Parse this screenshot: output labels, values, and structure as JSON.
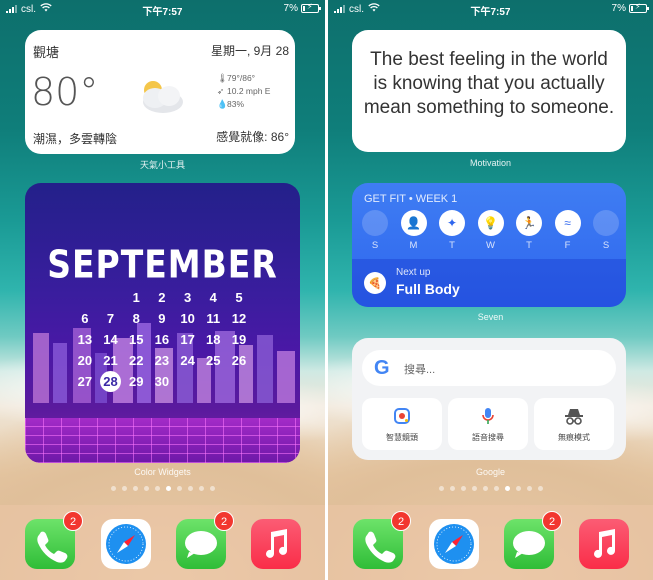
{
  "status": {
    "carrier": "csl.",
    "time": "下午7:57",
    "battery": "7%"
  },
  "left": {
    "weather": {
      "location": "觀塘",
      "date": "星期一, 9月 28",
      "temperature": "80°",
      "hi_lo": "79°/86°",
      "wind": "10.2 mph E",
      "humidity": "83%",
      "description": "潮濕，多雲轉陰",
      "feels_like": "感覺就像: 86°",
      "caption": "天氣小工具"
    },
    "calendar": {
      "month": "SEPTEMBER",
      "today": "28",
      "weeks": [
        [
          "",
          "",
          "1",
          "2",
          "3",
          "4",
          "5"
        ],
        [
          "6",
          "7",
          "8",
          "9",
          "10",
          "11",
          "12"
        ],
        [
          "13",
          "14",
          "15",
          "16",
          "17",
          "18",
          "19"
        ],
        [
          "20",
          "21",
          "22",
          "23",
          "24",
          "25",
          "26"
        ],
        [
          "27",
          "28",
          "29",
          "30",
          "",
          "",
          ""
        ]
      ],
      "caption": "Color Widgets"
    }
  },
  "right": {
    "motivation": {
      "quote": "The best feeling in the world is knowing that you actually mean something to someone.",
      "caption": "Motivation"
    },
    "fit": {
      "title": "GET FIT • WEEK 1",
      "days": [
        "S",
        "M",
        "T",
        "W",
        "T",
        "F",
        "S"
      ],
      "active": [
        false,
        true,
        true,
        true,
        true,
        true,
        false
      ],
      "next_up": "Next up",
      "workout": "Full Body",
      "caption": "Seven"
    },
    "google": {
      "placeholder": "搜尋...",
      "buttons": [
        "智慧鏡頭",
        "語音搜尋",
        "無痕模式"
      ],
      "caption": "Google"
    }
  },
  "dock": {
    "phone_badge": "2",
    "messages_badge": "2"
  },
  "page_dots": {
    "count": 10,
    "left_active_index": 5,
    "right_active_index": 6
  }
}
